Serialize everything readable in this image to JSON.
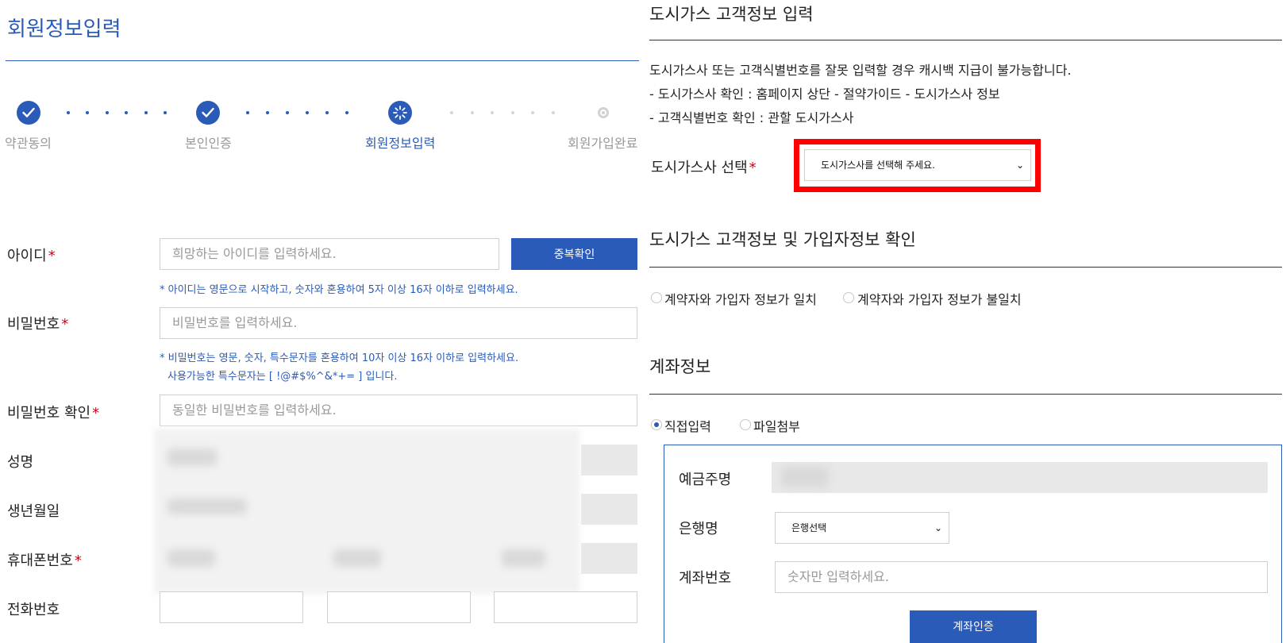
{
  "page": {
    "title": "회원정보입력"
  },
  "stepper": {
    "steps": [
      {
        "label": "약관동의",
        "state": "done"
      },
      {
        "label": "본인인증",
        "state": "done"
      },
      {
        "label": "회원정보입력",
        "state": "current"
      },
      {
        "label": "회원가입완료",
        "state": "pending"
      }
    ]
  },
  "form": {
    "user_id": {
      "label": "아이디",
      "placeholder": "희망하는 아이디를 입력하세요.",
      "check_button": "중복확인",
      "hint": "* 아이디는 영문으로 시작하고, 숫자와 혼용하여 5자 이상 16자 이하로 입력하세요."
    },
    "password": {
      "label": "비밀번호",
      "placeholder": "비밀번호를 입력하세요.",
      "hint_line1": "* 비밀번호는 영문, 숫자, 특수문자를 혼용하여 10자 이상 16자 이하로 입력하세요.",
      "hint_line2": "사용가능한 특수문자는 [ !@#$%^&*+= ] 입니다."
    },
    "password_confirm": {
      "label": "비밀번호 확인",
      "placeholder": "동일한 비밀번호를 입력하세요."
    },
    "name": {
      "label": "성명"
    },
    "birth": {
      "label": "생년월일"
    },
    "mobile": {
      "label": "휴대폰번호"
    },
    "phone": {
      "label": "전화번호"
    },
    "required_mark": "*"
  },
  "gas": {
    "title": "도시가스 고객정보 입력",
    "notice_line1": "도시가스사 또는 고객식별번호를 잘못 입력할 경우 캐시백 지급이 불가능합니다.",
    "notice_line2": "- 도시가스사 확인 : 홈페이지 상단 - 절약가이드 - 도시가스사 정보",
    "notice_line3": "- 고객식별번호 확인 : 관할 도시가스사",
    "select_label": "도시가스사 선택",
    "select_value": "도시가스사를 선택해 주세요.",
    "highlight_color": "#ff0000"
  },
  "verify": {
    "title": "도시가스 고객정보 및 가입자정보 확인",
    "option_match": "계약자와 가입자 정보가 일치",
    "option_mismatch": "계약자와 가입자 정보가 불일치"
  },
  "account": {
    "title": "계좌정보",
    "option_direct": "직접입력",
    "option_file": "파일첨부",
    "holder_label": "예금주명",
    "bank_label": "은행명",
    "bank_value": "은행선택",
    "number_label": "계좌번호",
    "number_placeholder": "숫자만 입력하세요.",
    "verify_button": "계좌인증"
  },
  "colors": {
    "accent": "#2a5bb8",
    "required": "#d0021b"
  }
}
